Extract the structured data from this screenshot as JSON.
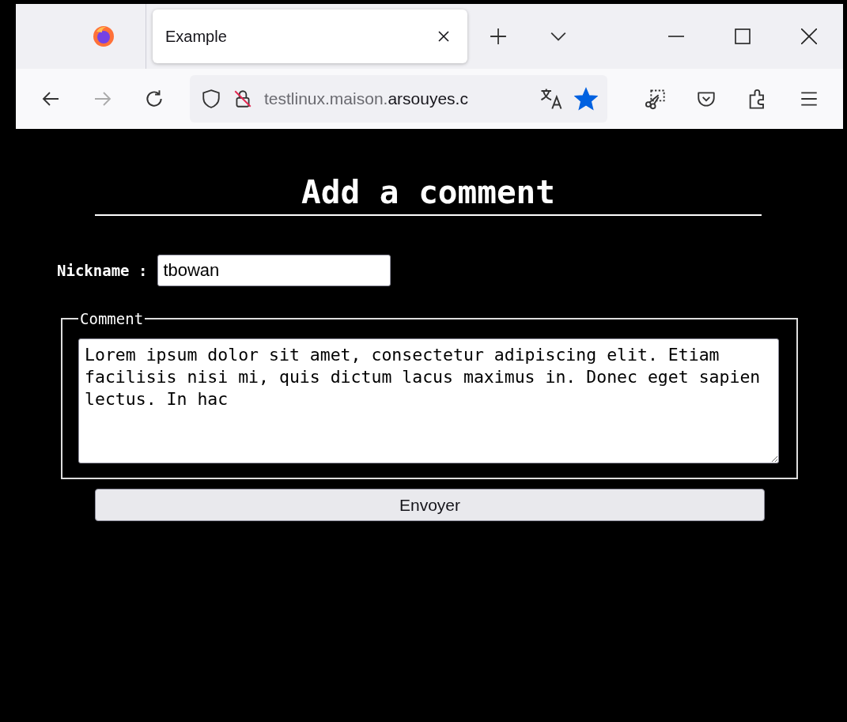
{
  "browser": {
    "tabs": [
      {
        "title": "Example",
        "selected": true
      }
    ],
    "nav": {
      "back_disabled": false,
      "forward_disabled": true
    },
    "address": {
      "subdomain": "testlinux.maison.",
      "domain": "arsouyes.c"
    },
    "bookmarked": true
  },
  "page": {
    "heading": "Add a comment",
    "nickname": {
      "label": "Nickname :",
      "value": "tbowan"
    },
    "comment": {
      "legend": "Comment",
      "value": "Lorem ipsum dolor sit amet, consectetur adipiscing elit. Etiam facilisis nisi mi, quis dictum lacus maximus in. Donec eget sapien lectus. In hac"
    },
    "submit": "Envoyer"
  }
}
